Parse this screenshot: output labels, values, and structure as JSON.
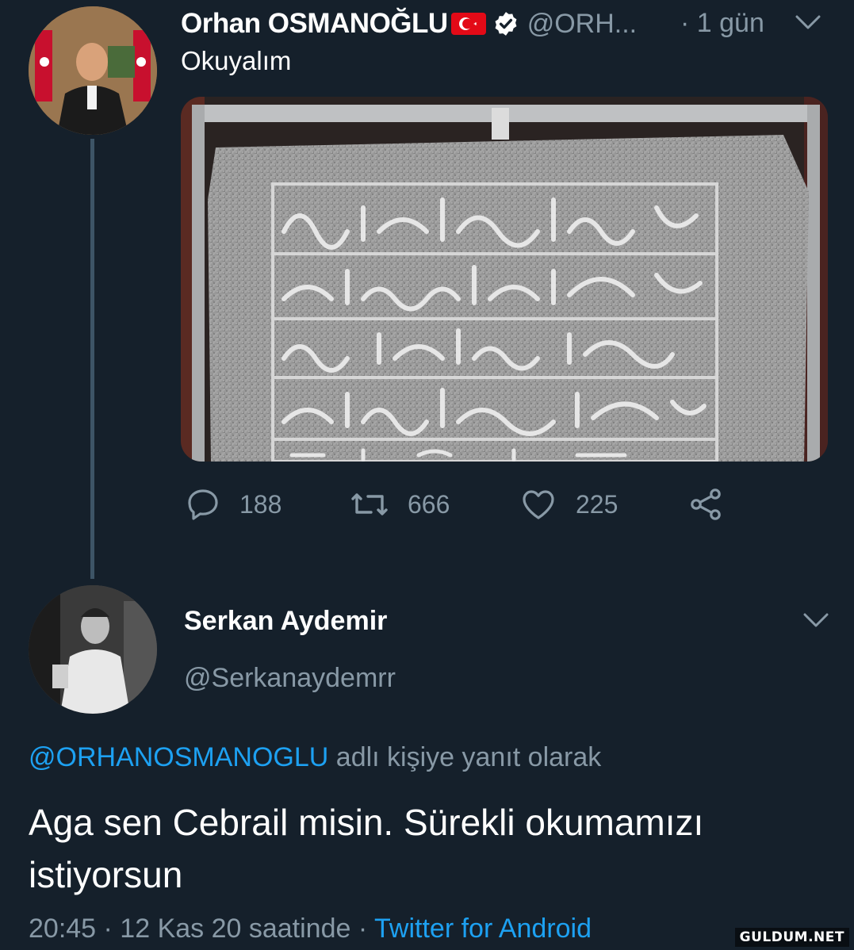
{
  "original_tweet": {
    "author_name": "Orhan OSMANOĞLU",
    "author_handle": "@ORH...",
    "time": "· 1 gün",
    "text": "Okuyalım",
    "image_icon": "inscription-stone-photo",
    "stats": {
      "replies": "188",
      "retweets": "666",
      "likes": "225"
    }
  },
  "reply_tweet": {
    "author_name": "Serkan Aydemir",
    "author_handle": "@Serkanaydemrr",
    "reply_to_handle": "@ORHANOSMANOGLU",
    "reply_to_suffix": " adlı kişiye yanıt olarak",
    "text": "Aga sen Cebrail misin. Sürekli okumamızı istiyorsun",
    "timestamp": "20:45 · 12 Kas 20 saatinde · ",
    "source": "Twitter for Android"
  },
  "watermark": "GULDUM.NET",
  "colors": {
    "background": "#15202b",
    "secondary_text": "#8899a6",
    "link": "#1da1f2",
    "thread_line": "#3d5466"
  }
}
